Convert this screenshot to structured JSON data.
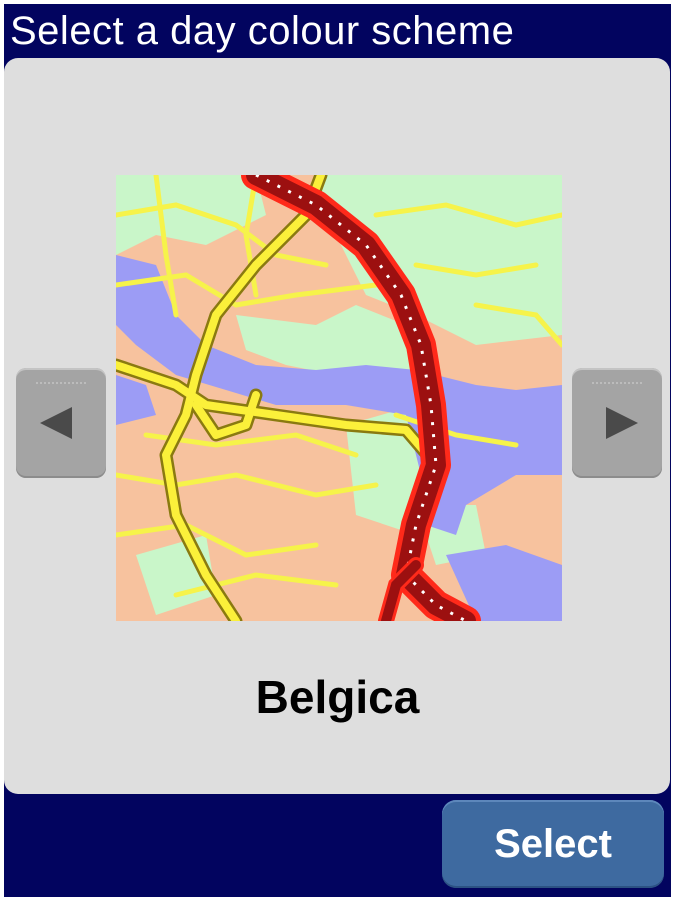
{
  "header": {
    "title": "Select a day colour scheme"
  },
  "preview": {
    "scheme_name": "Belgica",
    "colors": {
      "land": "#f7c29e",
      "park": "#c9f6c9",
      "water": "#9c9cf5",
      "minor_road": "#f6f34a",
      "major_road": "#fbf03a",
      "motorway_fill": "#9c1010",
      "motorway_edge": "#ff2a1a"
    }
  },
  "nav": {
    "prev_icon": "triangle-left-icon",
    "next_icon": "triangle-right-icon"
  },
  "footer": {
    "select_label": "Select"
  },
  "theme": {
    "frame": "#02045f",
    "panel": "#dedede",
    "button_gray": "#a4a4a4",
    "button_blue": "#3e6aa0"
  }
}
